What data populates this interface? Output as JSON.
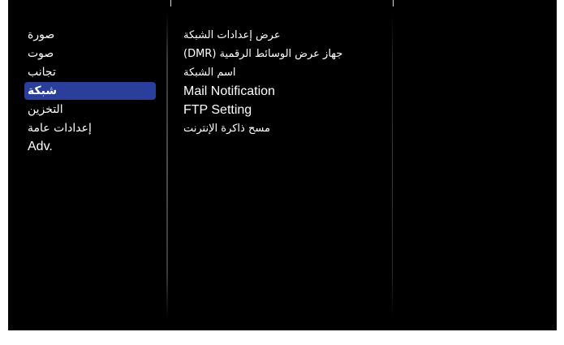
{
  "menu": {
    "items": [
      {
        "label": "صورة",
        "selected": false
      },
      {
        "label": "صوت",
        "selected": false
      },
      {
        "label": "تجانب",
        "selected": false
      },
      {
        "label": "شبكة",
        "selected": true
      },
      {
        "label": "التخزين",
        "selected": false
      },
      {
        "label": "إعدادات عامة",
        "selected": false
      },
      {
        "label": "Adv.",
        "selected": false
      }
    ]
  },
  "submenu": {
    "items": [
      {
        "label": "عرض إعدادات الشبكة"
      },
      {
        "label": "جهاز عرض الوسائط الرقمية (DMR)"
      },
      {
        "label": "اسم الشبكة"
      },
      {
        "label": "Mail Notification"
      },
      {
        "label": "FTP Setting"
      },
      {
        "label": "مسح ذاكرة الإنترنت"
      }
    ]
  },
  "colors": {
    "background": "#000000",
    "selected_highlight": "#2a3e9b",
    "text": "#ffffff"
  }
}
